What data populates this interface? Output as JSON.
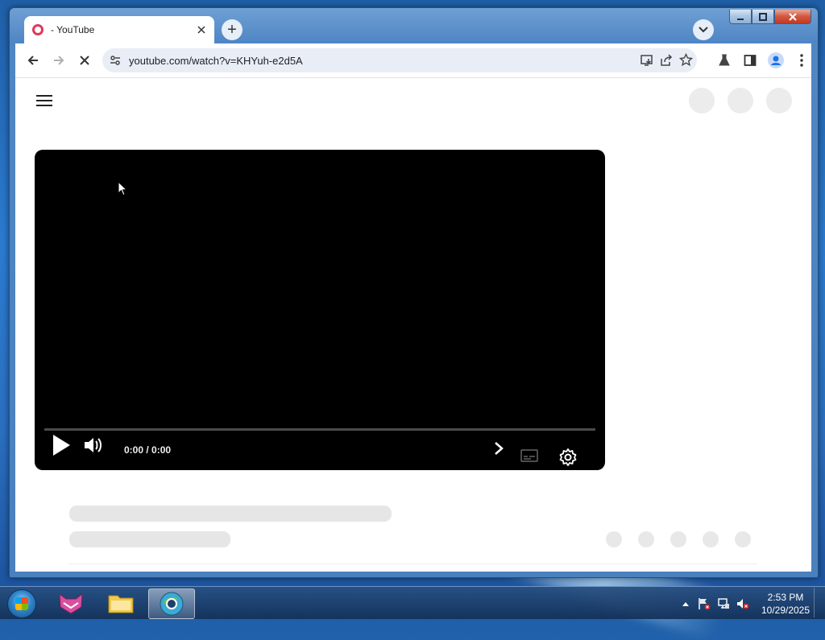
{
  "browser": {
    "tab": {
      "title": "- YouTube",
      "favicon": "youtube-loading-icon"
    },
    "new_tab_label": "+",
    "address": {
      "url": "youtube.com/watch?v=KHYuh-e2d5A"
    }
  },
  "player": {
    "time": "0:00 / 0:00"
  },
  "taskbar": {
    "clock": {
      "time": "2:53 PM",
      "date": "10/29/2025"
    }
  },
  "colors": {
    "accent": "#1a73e8",
    "favicon": "#e0385a",
    "player_bg": "#000000"
  }
}
